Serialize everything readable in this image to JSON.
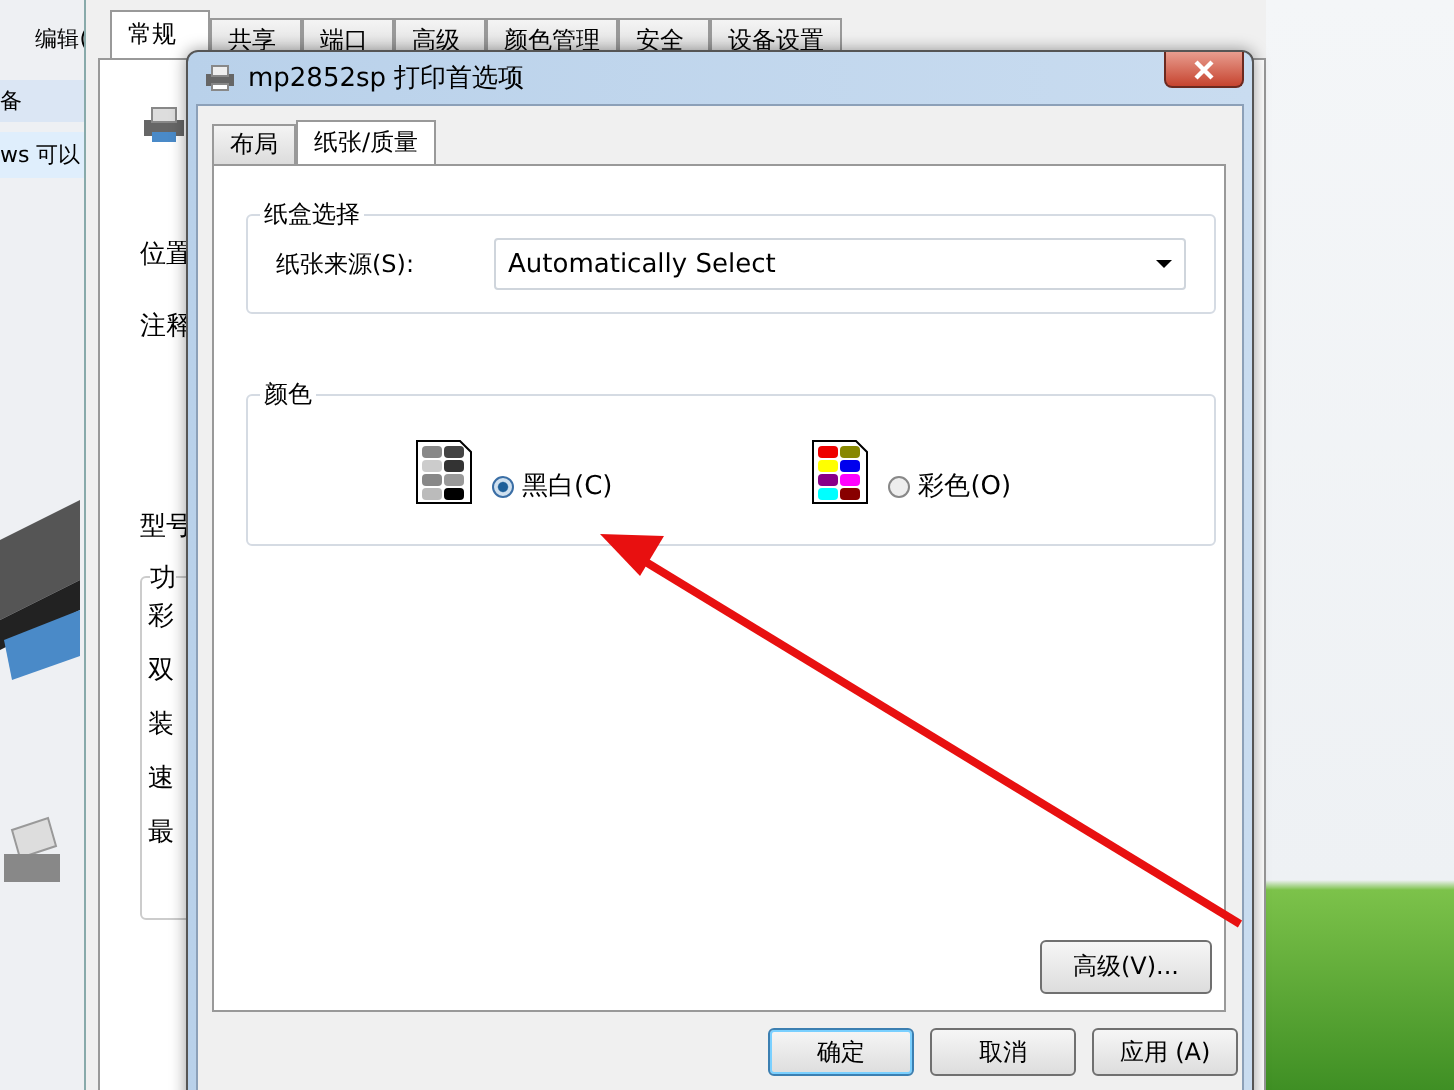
{
  "explorer_window": {
    "menu_text": "编辑(",
    "toolbar_text": "备",
    "info_text": "ws 可以"
  },
  "properties_window": {
    "tabs": [
      {
        "label": "常规",
        "selected": true
      },
      {
        "label": "共享",
        "selected": false
      },
      {
        "label": "端口",
        "selected": false
      },
      {
        "label": "高级",
        "selected": false
      },
      {
        "label": "颜色管理",
        "selected": false
      },
      {
        "label": "安全",
        "selected": false
      },
      {
        "label": "设备设置",
        "selected": false
      }
    ],
    "labels": [
      "位置",
      "注释",
      "型号"
    ],
    "feature_group": {
      "legend": "功",
      "items": [
        "彩",
        "双",
        "装",
        "速",
        "最"
      ]
    }
  },
  "dialog": {
    "title": "mp2852sp 打印首选项",
    "tabs": [
      {
        "label": "布局",
        "selected": false
      },
      {
        "label": "纸张/质量",
        "selected": true
      }
    ],
    "paper_group": {
      "legend": "纸盒选择",
      "source_label": "纸张来源(S):",
      "source_value": "Automatically Select"
    },
    "color_group": {
      "legend": "颜色",
      "options": [
        {
          "kind": "mono",
          "label": "黑白(C)",
          "selected": true
        },
        {
          "kind": "color",
          "label": "彩色(O)",
          "selected": false
        }
      ]
    },
    "advanced_button": "高级(V)...",
    "buttons": [
      {
        "label": "确定",
        "default": true
      },
      {
        "label": "取消",
        "default": false
      },
      {
        "label": "应用 (A)",
        "default": false
      }
    ]
  }
}
